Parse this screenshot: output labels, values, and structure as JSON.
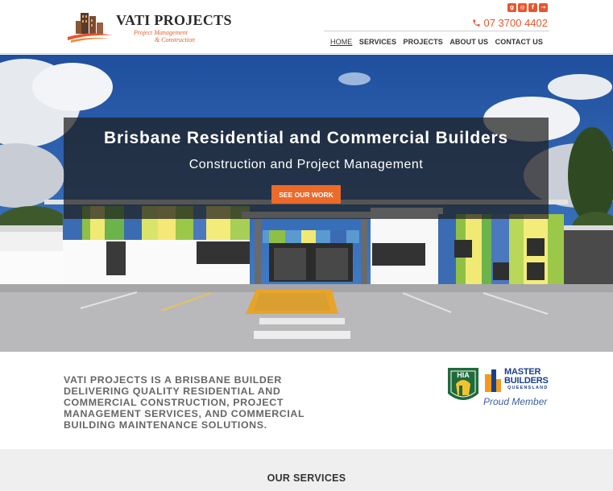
{
  "header": {
    "logo_title": "VATI PROJECTS",
    "logo_subtitle_1": "Project Management",
    "logo_subtitle_2": "& Construction",
    "social_icons": [
      "google-plus-icon",
      "instagram-icon",
      "facebook-icon",
      "login-icon"
    ],
    "phone": "07 3700 4402",
    "nav": [
      {
        "label": "HOME",
        "active": true
      },
      {
        "label": "SERVICES",
        "active": false
      },
      {
        "label": "PROJECTS",
        "active": false
      },
      {
        "label": "ABOUT US",
        "active": false
      },
      {
        "label": "CONTACT US",
        "active": false
      }
    ]
  },
  "hero": {
    "title": "Brisbane Residential and Commercial Builders",
    "subtitle": "Construction and Project Management",
    "cta_label": "SEE OUR WORK"
  },
  "intro": {
    "text": "VATI PROJECTS IS A BRISBANE BUILDER DELIVERING QUALITY RESIDENTIAL AND COMMERCIAL CONSTRUCTION, PROJECT MANAGEMENT SERVICES, AND COMMERCIAL BUILDING MAINTENANCE SOLUTIONS."
  },
  "badges": {
    "hia_label": "HIA",
    "master_builders_line1": "MASTER",
    "master_builders_line2": "BUILDERS",
    "master_builders_line3": "QUEENSLAND",
    "proud_member": "Proud Member"
  },
  "services": {
    "title": "OUR SERVICES"
  },
  "colors": {
    "accent": "#e8552d",
    "button": "#ec6a2a",
    "mb_blue": "#1a3f8a",
    "hia_green": "#1f6b3a"
  }
}
